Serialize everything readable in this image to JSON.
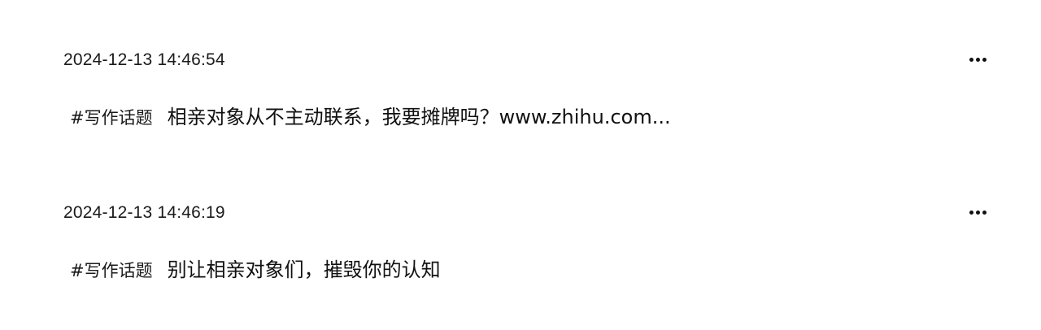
{
  "posts": [
    {
      "timestamp": "2024-12-13 14:46:54",
      "topic": "#写作话题",
      "text": "相亲对象从不主动联系，我要摊牌吗？www.zhihu.com...",
      "more_icon": "more-horizontal-icon"
    },
    {
      "timestamp": "2024-12-13 14:46:19",
      "topic": "#写作话题",
      "text": "别让相亲对象们，摧毁你的认知",
      "more_icon": "more-horizontal-icon"
    }
  ],
  "colors": {
    "background": "#ffffff",
    "text": "#111111"
  }
}
